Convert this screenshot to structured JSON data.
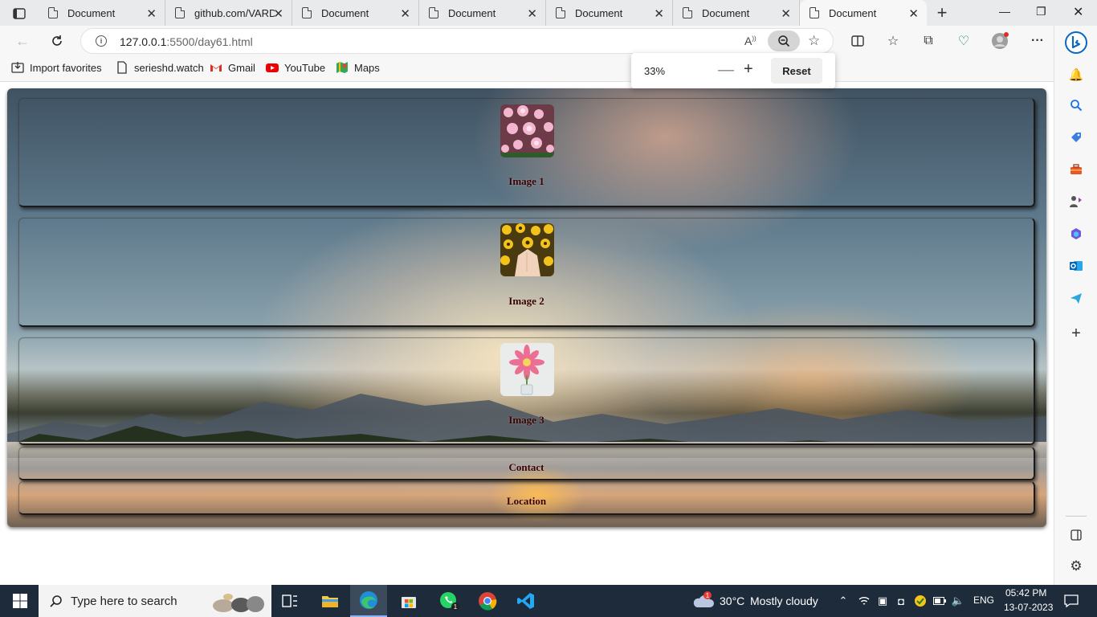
{
  "browser": {
    "tabs": [
      {
        "label": "Document",
        "active": false
      },
      {
        "label": "github.com/VARD",
        "active": false
      },
      {
        "label": "Document",
        "active": false
      },
      {
        "label": "Document",
        "active": false
      },
      {
        "label": "Document",
        "active": false
      },
      {
        "label": "Document",
        "active": false
      },
      {
        "label": "Document",
        "active": true
      }
    ],
    "address": {
      "host": "127.0.0.1",
      "rest": ":5500/day61.html"
    },
    "favorites": [
      {
        "label": "Import favorites",
        "icon": "import-icon"
      },
      {
        "label": "serieshd.watch",
        "icon": "page-icon"
      },
      {
        "label": "Gmail",
        "icon": "gmail-icon"
      },
      {
        "label": "YouTube",
        "icon": "youtube-icon"
      },
      {
        "label": "Maps",
        "icon": "maps-icon"
      }
    ],
    "zoom_popup": {
      "value": "33%",
      "reset_label": "Reset"
    }
  },
  "page": {
    "cards": [
      {
        "caption": "Image 1",
        "image": "pink-flowers"
      },
      {
        "caption": "Image 2",
        "image": "yellow-flowers-hands"
      },
      {
        "caption": "Image 3",
        "image": "pink-gerbera"
      }
    ],
    "links": [
      {
        "caption": "Contact"
      },
      {
        "caption": "Location"
      }
    ]
  },
  "taskbar": {
    "search_placeholder": "Type here to search",
    "weather": {
      "temp": "30°C",
      "desc": "Mostly cloudy",
      "badge": "1"
    },
    "whatsapp_badge": "1",
    "language": "ENG",
    "time": "05:42 PM",
    "date": "13-07-2023"
  },
  "colors": {
    "caption": "#3a0000",
    "taskbar": "#1d2b3a",
    "edge_accent": "#0a66c2"
  }
}
